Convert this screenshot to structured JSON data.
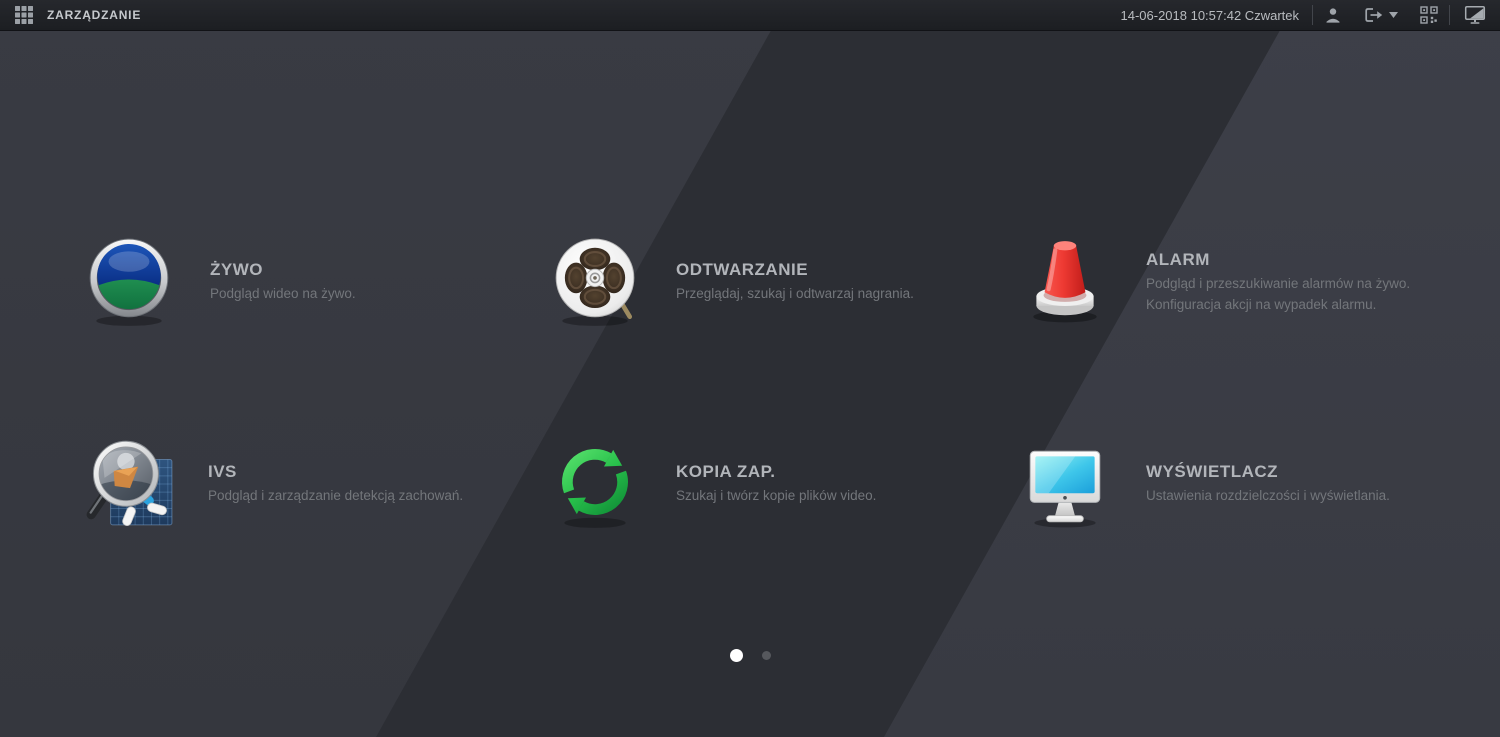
{
  "topbar": {
    "app_title": "ZARZĄDZANIE",
    "datetime": "14-06-2018 10:57:42 Czwartek",
    "icons": {
      "apps": "apps-grid-icon",
      "user": "user-icon",
      "logout": "logout-icon",
      "qr": "qr-code-icon",
      "display": "display-adjust-icon"
    }
  },
  "menu": {
    "items": [
      {
        "title": "ŻYWO",
        "desc": "Podgląd wideo na żywo.",
        "desc2": "",
        "icon": "live-view-lens-icon"
      },
      {
        "title": "ODTWARZANIE",
        "desc": "Przeglądaj, szukaj i odtwarzaj nagrania.",
        "desc2": "",
        "icon": "playback-film-reel-icon"
      },
      {
        "title": "ALARM",
        "desc": "Podgląd i przeszukiwanie alarmów na żywo.",
        "desc2": "Konfiguracja akcji na wypadek alarmu.",
        "icon": "alarm-siren-icon"
      },
      {
        "title": "IVS",
        "desc": "Podgląd i zarządzanie detekcją zachowań.",
        "desc2": "",
        "icon": "ivs-magnifier-icon"
      },
      {
        "title": "KOPIA ZAP.",
        "desc": "Szukaj i twórz kopie plików video.",
        "desc2": "",
        "icon": "backup-sync-icon"
      },
      {
        "title": "WYŚWIETLACZ",
        "desc": "Ustawienia rozdzielczości i wyświetlania.",
        "desc2": "",
        "icon": "display-monitor-icon"
      }
    ]
  },
  "pagination": {
    "total_pages": 2,
    "active_page": 1
  },
  "colors": {
    "bar_bg": "#1f2125",
    "bg_dark": "#2c2e34",
    "bg_light": "#393b43",
    "accent_green": "#2dbb4c",
    "accent_red": "#e02b26",
    "accent_cyan": "#3ec6ea",
    "title_text": "#b2b5ba",
    "desc_text": "#73767b"
  }
}
